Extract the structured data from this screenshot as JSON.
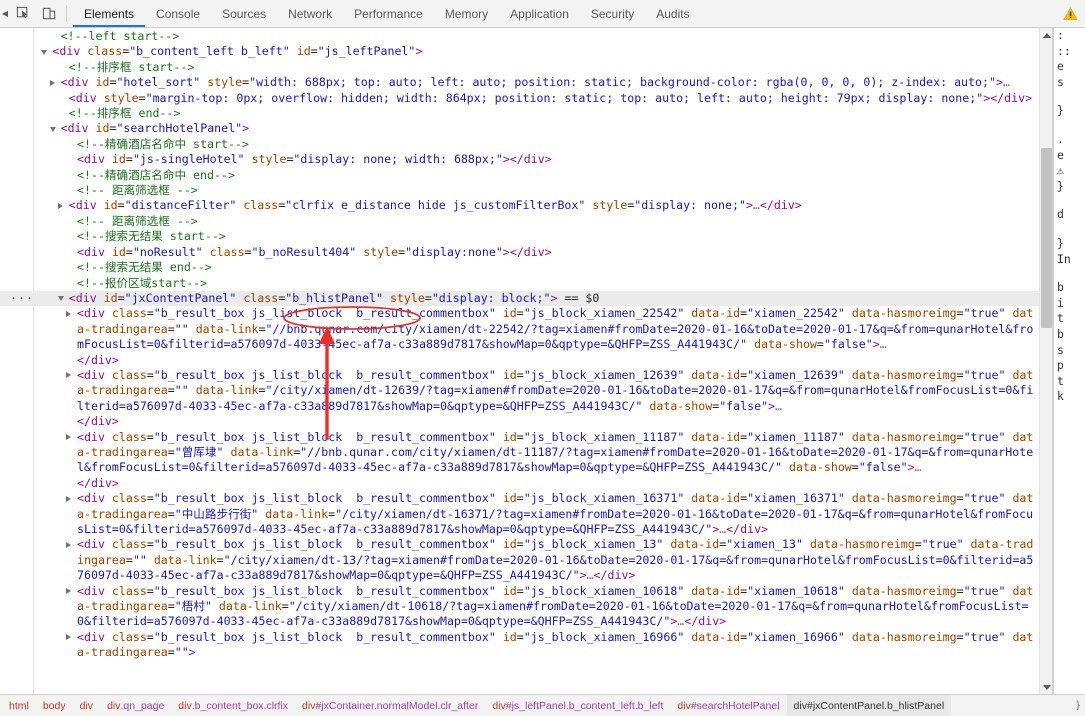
{
  "toolbar": {
    "inspect_icon": "inspect-cursor-icon",
    "device_icon": "device-toolbar-icon",
    "warning_icon": "warning-triangle-icon",
    "collapse_icon": "chevron-left-icon",
    "tabs": [
      {
        "label": "Elements",
        "active": true
      },
      {
        "label": "Console",
        "active": false
      },
      {
        "label": "Sources",
        "active": false
      },
      {
        "label": "Network",
        "active": false
      },
      {
        "label": "Performance",
        "active": false
      },
      {
        "label": "Memory",
        "active": false
      },
      {
        "label": "Application",
        "active": false
      },
      {
        "label": "Security",
        "active": false
      },
      {
        "label": "Audits",
        "active": false
      }
    ]
  },
  "dom": {
    "selected_marker": "== $0",
    "dots_label": "···",
    "lines": [
      {
        "kind": "comment",
        "indent": 3,
        "text": "<!--left start-->"
      },
      {
        "kind": "open",
        "indent": 2,
        "toggle": "down",
        "tag": "div",
        "attrs": [
          [
            "class",
            "b_content_left b_left"
          ],
          [
            "id",
            "js_leftPanel"
          ]
        ]
      },
      {
        "kind": "comment",
        "indent": 4,
        "text": "<!--排序框 start-->"
      },
      {
        "kind": "collapsed",
        "indent": 3,
        "toggle": "right",
        "tag": "div",
        "attrs": [
          [
            "id",
            "hotel_sort"
          ],
          [
            "style",
            "width: 688px; top: auto; left: auto; position: static; background-color: rgba(0, 0, 0, 0); z-index: auto;"
          ]
        ]
      },
      {
        "kind": "empty",
        "indent": 4,
        "tag": "div",
        "attrs": [
          [
            "style",
            "margin-top: 0px; overflow: hidden; width: 864px; position: static; top: auto; left: auto; height: 79px; display: none;"
          ]
        ]
      },
      {
        "kind": "comment",
        "indent": 4,
        "text": "<!--排序框 end-->"
      },
      {
        "kind": "open",
        "indent": 3,
        "toggle": "down",
        "tag": "div",
        "attrs": [
          [
            "id",
            "searchHotelPanel"
          ]
        ]
      },
      {
        "kind": "comment",
        "indent": 5,
        "text": "<!--精确酒店名命中 start-->"
      },
      {
        "kind": "empty",
        "indent": 5,
        "tag": "div",
        "attrs": [
          [
            "id",
            "js-singleHotel"
          ],
          [
            "style",
            "display: none; width: 688px;"
          ]
        ]
      },
      {
        "kind": "comment",
        "indent": 5,
        "text": "<!--精确酒店名命中 end-->"
      },
      {
        "kind": "comment",
        "indent": 5,
        "text": "<!-- 距离筛选框 -->"
      },
      {
        "kind": "collapsed",
        "indent": 4,
        "toggle": "right",
        "tag": "div",
        "attrs": [
          [
            "id",
            "distanceFilter"
          ],
          [
            "class",
            "clrfix e_distance hide js_customFilterBox"
          ],
          [
            "style",
            "display: none;"
          ]
        ],
        "tail": "…</div>"
      },
      {
        "kind": "comment",
        "indent": 5,
        "text": "<!-- 距离筛选框 -->"
      },
      {
        "kind": "comment",
        "indent": 5,
        "text": "<!--搜索无结果 start-->"
      },
      {
        "kind": "empty",
        "indent": 5,
        "tag": "div",
        "attrs": [
          [
            "id",
            "noResult"
          ],
          [
            "class",
            "b_noResult404"
          ],
          [
            "style",
            "display:none"
          ]
        ]
      },
      {
        "kind": "comment",
        "indent": 5,
        "text": "<!--搜索无结果 end-->"
      },
      {
        "kind": "comment",
        "indent": 5,
        "text": "<!--报价区域start-->"
      },
      {
        "kind": "open",
        "indent": 4,
        "toggle": "down",
        "tag": "div",
        "selected": true,
        "attrs": [
          [
            "id",
            "jxContentPanel"
          ],
          [
            "class",
            "b_hlistPanel"
          ],
          [
            "style",
            "display: block;"
          ]
        ],
        "suffix": " == $0"
      },
      {
        "kind": "collapsed",
        "indent": 5,
        "toggle": "right",
        "tag": "div",
        "attrs": [
          [
            "class",
            "b_result_box js_list_block  b_result_commentbox"
          ],
          [
            "id",
            "js_block_xiamen_22542"
          ],
          [
            "data-id",
            "xiamen_22542"
          ],
          [
            "data-hasmoreimg",
            "true"
          ],
          [
            "data-tradingarea",
            ""
          ],
          [
            "data-link",
            "//bnb.qunar.com/city/xiamen/dt-22542/?tag=xiamen#fromDate=2020-01-16&toDate=2020-01-17&q=&from=qunarHotel&fromFocusList=0&filterid=a576097d-4033-45ec-af7a-c33a889d7817&showMap=0&qptype=&QHFP=ZSS_A441943C/"
          ],
          [
            "data-show",
            "false"
          ]
        ],
        "tail": "…"
      },
      {
        "kind": "close",
        "indent": 5,
        "tag": "div"
      },
      {
        "kind": "collapsed",
        "indent": 5,
        "toggle": "right",
        "tag": "div",
        "attrs": [
          [
            "class",
            "b_result_box js_list_block  b_result_commentbox"
          ],
          [
            "id",
            "js_block_xiamen_12639"
          ],
          [
            "data-id",
            "xiamen_12639"
          ],
          [
            "data-hasmoreimg",
            "true"
          ],
          [
            "data-tradingarea",
            ""
          ],
          [
            "data-link",
            "/city/xiamen/dt-12639/?tag=xiamen#fromDate=2020-01-16&toDate=2020-01-17&q=&from=qunarHotel&fromFocusList=0&filterid=a576097d-4033-45ec-af7a-c33a889d7817&showMap=0&qptype=&QHFP=ZSS_A441943C/"
          ],
          [
            "data-show",
            "false"
          ]
        ],
        "tail": "…"
      },
      {
        "kind": "close",
        "indent": 5,
        "tag": "div"
      },
      {
        "kind": "collapsed",
        "indent": 5,
        "toggle": "right",
        "tag": "div",
        "attrs": [
          [
            "class",
            "b_result_box js_list_block  b_result_commentbox"
          ],
          [
            "id",
            "js_block_xiamen_11187"
          ],
          [
            "data-id",
            "xiamen_11187"
          ],
          [
            "data-hasmoreimg",
            "true"
          ],
          [
            "data-tradingarea",
            "曾厍埭"
          ],
          [
            "data-link",
            "//bnb.qunar.com/city/xiamen/dt-11187/?tag=xiamen#fromDate=2020-01-16&toDate=2020-01-17&q=&from=qunarHotel&fromFocusList=0&filterid=a576097d-4033-45ec-af7a-c33a889d7817&showMap=0&qptype=&QHFP=ZSS_A441943C/"
          ],
          [
            "data-show",
            "false"
          ]
        ],
        "tail": "…"
      },
      {
        "kind": "close",
        "indent": 5,
        "tag": "div"
      },
      {
        "kind": "collapsed",
        "indent": 5,
        "toggle": "right",
        "tag": "div",
        "attrs": [
          [
            "class",
            "b_result_box js_list_block  b_result_commentbox"
          ],
          [
            "id",
            "js_block_xiamen_16371"
          ],
          [
            "data-id",
            "xiamen_16371"
          ],
          [
            "data-hasmoreimg",
            "true"
          ],
          [
            "data-tradingarea",
            "中山路步行街"
          ],
          [
            "data-link",
            "/city/xiamen/dt-16371/?tag=xiamen#fromDate=2020-01-16&toDate=2020-01-17&q=&from=qunarHotel&fromFocusList=0&filterid=a576097d-4033-45ec-af7a-c33a889d7817&showMap=0&qptype=&QHFP=ZSS_A441943C/"
          ]
        ],
        "tail": "…</div>"
      },
      {
        "kind": "collapsed",
        "indent": 5,
        "toggle": "right",
        "tag": "div",
        "attrs": [
          [
            "class",
            "b_result_box js_list_block  b_result_commentbox"
          ],
          [
            "id",
            "js_block_xiamen_13"
          ],
          [
            "data-id",
            "xiamen_13"
          ],
          [
            "data-hasmoreimg",
            "true"
          ],
          [
            "data-tradingarea",
            ""
          ],
          [
            "data-link",
            "/city/xiamen/dt-13/?tag=xiamen#fromDate=2020-01-16&toDate=2020-01-17&q=&from=qunarHotel&fromFocusList=0&filterid=a576097d-4033-45ec-af7a-c33a889d7817&showMap=0&qptype=&QHFP=ZSS_A441943C/"
          ]
        ],
        "tail": "…</div>"
      },
      {
        "kind": "collapsed",
        "indent": 5,
        "toggle": "right",
        "tag": "div",
        "attrs": [
          [
            "class",
            "b_result_box js_list_block  b_result_commentbox"
          ],
          [
            "id",
            "js_block_xiamen_10618"
          ],
          [
            "data-id",
            "xiamen_10618"
          ],
          [
            "data-hasmoreimg",
            "true"
          ],
          [
            "data-tradingarea",
            "梧村"
          ],
          [
            "data-link",
            "/city/xiamen/dt-10618/?tag=xiamen#fromDate=2020-01-16&toDate=2020-01-17&q=&from=qunarHotel&fromFocusList=0&filterid=a576097d-4033-45ec-af7a-c33a889d7817&showMap=0&qptype=&QHFP=ZSS_A441943C/"
          ]
        ],
        "tail": "…</div>"
      },
      {
        "kind": "collapsed",
        "indent": 5,
        "toggle": "right",
        "tag": "div",
        "attrs": [
          [
            "class",
            "b_result_box js_list_block  b_result_commentbox"
          ],
          [
            "id",
            "js_block_xiamen_16966"
          ],
          [
            "data-id",
            "xiamen_16966"
          ],
          [
            "data-hasmoreimg",
            "true"
          ],
          [
            "data-tradingarea",
            ""
          ]
        ],
        "tail": ""
      }
    ]
  },
  "styles_strip": {
    "lines": [
      ":",
      "::",
      "e",
      "s",
      "",
      "}",
      "",
      ".",
      "e",
      "⚠",
      "}",
      "",
      "d",
      "",
      "}",
      "In",
      "",
      "b",
      "i",
      "t",
      "b",
      "s",
      "p",
      "t",
      "k"
    ]
  },
  "breadcrumbs": [
    {
      "el": "html",
      "id": "",
      "active": false
    },
    {
      "el": "body",
      "id": "",
      "active": false
    },
    {
      "el": "div",
      "id": "",
      "active": false
    },
    {
      "el": "div",
      "id": ".qn_page",
      "active": false
    },
    {
      "el": "div",
      "id": ".b_content_box.clrfix",
      "active": false
    },
    {
      "el": "div",
      "id": "#jxContainer.normalModel.clr_after",
      "active": false
    },
    {
      "el": "div",
      "id": "#js_leftPanel.b_content_left.b_left",
      "active": false
    },
    {
      "el": "div",
      "id": "#searchHotelPanel",
      "active": false
    },
    {
      "el": "div",
      "id": "#jxContentPanel.b_hlistPanel",
      "active": true
    }
  ],
  "annotation": {
    "shape": "red-ellipse-and-arrow",
    "color": "#e8312a",
    "target_text": "class=\"b_hlistPanel\""
  },
  "scrollbar": {
    "up_icon": "scroll-up-arrow-icon",
    "down_icon": "scroll-down-arrow-icon"
  }
}
